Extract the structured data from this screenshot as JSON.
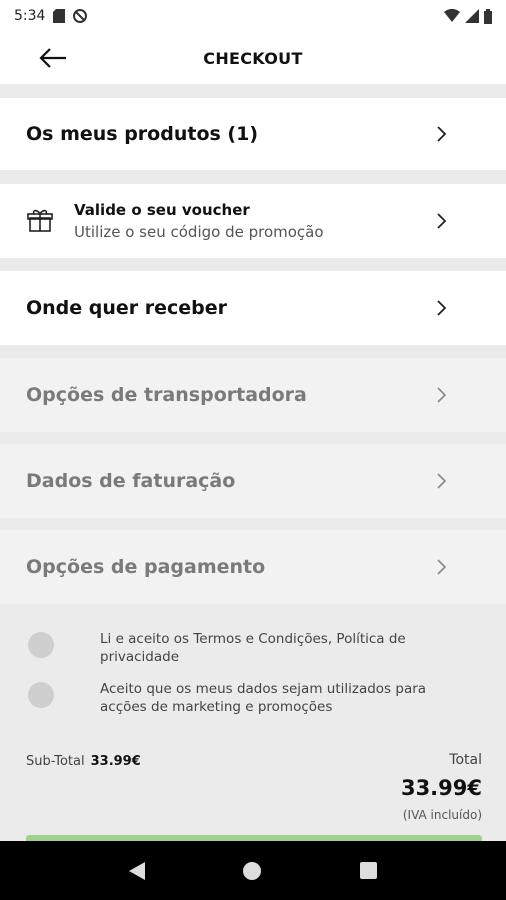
{
  "status": {
    "time": "5:34"
  },
  "header": {
    "title": "CHECKOUT"
  },
  "rows": {
    "products": "Os meus produtos (1)",
    "voucher_title": "Valide o seu voucher",
    "voucher_sub": "Utilize o seu código de promoção",
    "delivery": "Onde quer receber",
    "carrier": "Opções de transportadora",
    "billing": "Dados de faturação",
    "payment": "Opções de pagamento"
  },
  "consents": {
    "terms": "Li e aceito os Termos e Condições, Política de privacidade",
    "marketing": "Aceito que os meus dados sejam utilizados para acções de marketing e promoções"
  },
  "totals": {
    "subtotal_label": "Sub-Total",
    "subtotal_value": "33.99€",
    "total_label": "Total",
    "total_value": "33.99€",
    "vat_note": "(IVA incluído)"
  },
  "icons": {
    "back": "arrow-left-icon",
    "chevron": "chevron-right-icon",
    "voucher": "gift-icon"
  },
  "colors": {
    "accent": "#9fd18f"
  }
}
